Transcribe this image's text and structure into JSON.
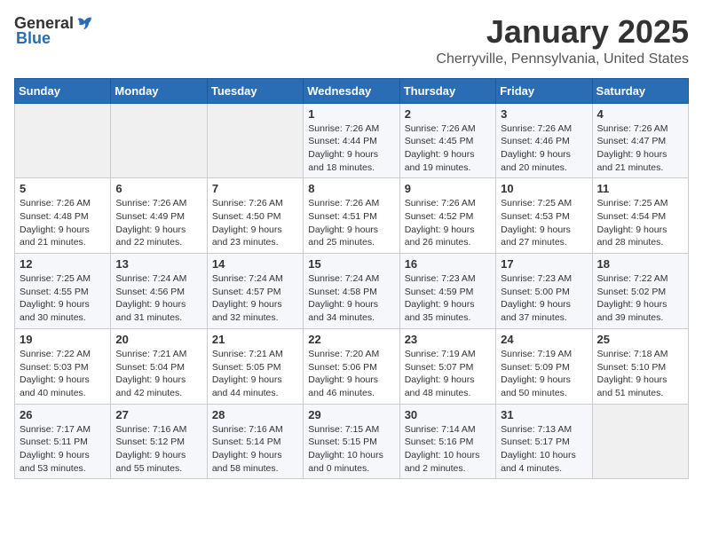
{
  "header": {
    "logo_general": "General",
    "logo_blue": "Blue",
    "month": "January 2025",
    "location": "Cherryville, Pennsylvania, United States"
  },
  "weekdays": [
    "Sunday",
    "Monday",
    "Tuesday",
    "Wednesday",
    "Thursday",
    "Friday",
    "Saturday"
  ],
  "weeks": [
    [
      {
        "day": "",
        "info": ""
      },
      {
        "day": "",
        "info": ""
      },
      {
        "day": "",
        "info": ""
      },
      {
        "day": "1",
        "info": "Sunrise: 7:26 AM\nSunset: 4:44 PM\nDaylight: 9 hours\nand 18 minutes."
      },
      {
        "day": "2",
        "info": "Sunrise: 7:26 AM\nSunset: 4:45 PM\nDaylight: 9 hours\nand 19 minutes."
      },
      {
        "day": "3",
        "info": "Sunrise: 7:26 AM\nSunset: 4:46 PM\nDaylight: 9 hours\nand 20 minutes."
      },
      {
        "day": "4",
        "info": "Sunrise: 7:26 AM\nSunset: 4:47 PM\nDaylight: 9 hours\nand 21 minutes."
      }
    ],
    [
      {
        "day": "5",
        "info": "Sunrise: 7:26 AM\nSunset: 4:48 PM\nDaylight: 9 hours\nand 21 minutes."
      },
      {
        "day": "6",
        "info": "Sunrise: 7:26 AM\nSunset: 4:49 PM\nDaylight: 9 hours\nand 22 minutes."
      },
      {
        "day": "7",
        "info": "Sunrise: 7:26 AM\nSunset: 4:50 PM\nDaylight: 9 hours\nand 23 minutes."
      },
      {
        "day": "8",
        "info": "Sunrise: 7:26 AM\nSunset: 4:51 PM\nDaylight: 9 hours\nand 25 minutes."
      },
      {
        "day": "9",
        "info": "Sunrise: 7:26 AM\nSunset: 4:52 PM\nDaylight: 9 hours\nand 26 minutes."
      },
      {
        "day": "10",
        "info": "Sunrise: 7:25 AM\nSunset: 4:53 PM\nDaylight: 9 hours\nand 27 minutes."
      },
      {
        "day": "11",
        "info": "Sunrise: 7:25 AM\nSunset: 4:54 PM\nDaylight: 9 hours\nand 28 minutes."
      }
    ],
    [
      {
        "day": "12",
        "info": "Sunrise: 7:25 AM\nSunset: 4:55 PM\nDaylight: 9 hours\nand 30 minutes."
      },
      {
        "day": "13",
        "info": "Sunrise: 7:24 AM\nSunset: 4:56 PM\nDaylight: 9 hours\nand 31 minutes."
      },
      {
        "day": "14",
        "info": "Sunrise: 7:24 AM\nSunset: 4:57 PM\nDaylight: 9 hours\nand 32 minutes."
      },
      {
        "day": "15",
        "info": "Sunrise: 7:24 AM\nSunset: 4:58 PM\nDaylight: 9 hours\nand 34 minutes."
      },
      {
        "day": "16",
        "info": "Sunrise: 7:23 AM\nSunset: 4:59 PM\nDaylight: 9 hours\nand 35 minutes."
      },
      {
        "day": "17",
        "info": "Sunrise: 7:23 AM\nSunset: 5:00 PM\nDaylight: 9 hours\nand 37 minutes."
      },
      {
        "day": "18",
        "info": "Sunrise: 7:22 AM\nSunset: 5:02 PM\nDaylight: 9 hours\nand 39 minutes."
      }
    ],
    [
      {
        "day": "19",
        "info": "Sunrise: 7:22 AM\nSunset: 5:03 PM\nDaylight: 9 hours\nand 40 minutes."
      },
      {
        "day": "20",
        "info": "Sunrise: 7:21 AM\nSunset: 5:04 PM\nDaylight: 9 hours\nand 42 minutes."
      },
      {
        "day": "21",
        "info": "Sunrise: 7:21 AM\nSunset: 5:05 PM\nDaylight: 9 hours\nand 44 minutes."
      },
      {
        "day": "22",
        "info": "Sunrise: 7:20 AM\nSunset: 5:06 PM\nDaylight: 9 hours\nand 46 minutes."
      },
      {
        "day": "23",
        "info": "Sunrise: 7:19 AM\nSunset: 5:07 PM\nDaylight: 9 hours\nand 48 minutes."
      },
      {
        "day": "24",
        "info": "Sunrise: 7:19 AM\nSunset: 5:09 PM\nDaylight: 9 hours\nand 50 minutes."
      },
      {
        "day": "25",
        "info": "Sunrise: 7:18 AM\nSunset: 5:10 PM\nDaylight: 9 hours\nand 51 minutes."
      }
    ],
    [
      {
        "day": "26",
        "info": "Sunrise: 7:17 AM\nSunset: 5:11 PM\nDaylight: 9 hours\nand 53 minutes."
      },
      {
        "day": "27",
        "info": "Sunrise: 7:16 AM\nSunset: 5:12 PM\nDaylight: 9 hours\nand 55 minutes."
      },
      {
        "day": "28",
        "info": "Sunrise: 7:16 AM\nSunset: 5:14 PM\nDaylight: 9 hours\nand 58 minutes."
      },
      {
        "day": "29",
        "info": "Sunrise: 7:15 AM\nSunset: 5:15 PM\nDaylight: 10 hours\nand 0 minutes."
      },
      {
        "day": "30",
        "info": "Sunrise: 7:14 AM\nSunset: 5:16 PM\nDaylight: 10 hours\nand 2 minutes."
      },
      {
        "day": "31",
        "info": "Sunrise: 7:13 AM\nSunset: 5:17 PM\nDaylight: 10 hours\nand 4 minutes."
      },
      {
        "day": "",
        "info": ""
      }
    ]
  ]
}
